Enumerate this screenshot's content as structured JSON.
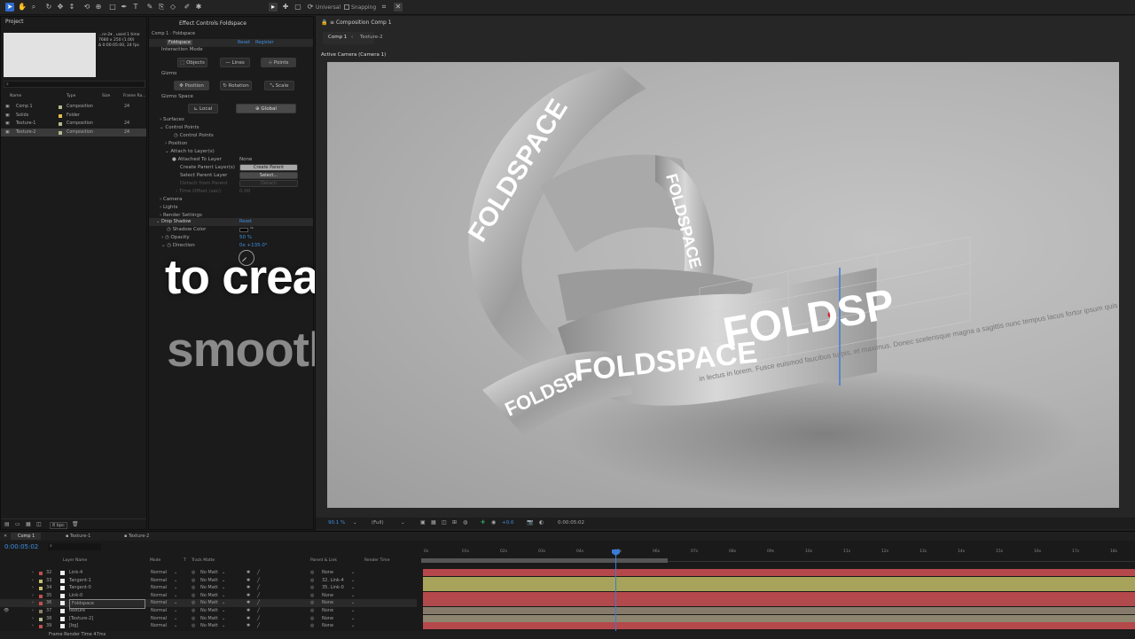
{
  "toolbar": {
    "universal_label": "Universal",
    "snapping_label": "Snapping"
  },
  "project": {
    "tab": "Project",
    "info_line1": "...re-2▾ , used 1 time",
    "info_line2": "7680 x 250 (1.00)",
    "info_line3": "Δ 0:00:05:00, 24 fps",
    "search_placeholder": "⌕",
    "col_name": "Name",
    "col_type": "Type",
    "col_size": "Size",
    "col_rate": "Frame Ra...",
    "items": [
      {
        "name": "Comp 1",
        "type": "Composition",
        "rate": "24",
        "color": "#b8b88f"
      },
      {
        "name": "Solids",
        "type": "Folder",
        "rate": "",
        "color": "#e0c04a"
      },
      {
        "name": "Texture-1",
        "type": "Composition",
        "rate": "24",
        "color": "#b8b88f"
      },
      {
        "name": "Texture-2",
        "type": "Composition",
        "rate": "24",
        "color": "#b8b88f"
      }
    ],
    "bpc": "8 bpc"
  },
  "effects": {
    "tab": "Effect Controls Foldspace",
    "breadcrumb": "Comp 1 · Foldspace",
    "effect_name": "Foldspace",
    "reset": "Reset",
    "register": "Register",
    "interaction_mode": "Interaction Mode",
    "objects": "Objects",
    "lines": "Lines",
    "points": "Points",
    "gizmo": "Gizmo",
    "position": "Position",
    "rotation": "Rotation",
    "scale": "Scale",
    "gizmo_space": "Gizmo Space",
    "local": "Local",
    "global": "Global",
    "surfaces": "Surfaces",
    "control_points": "Control Points",
    "control_points_sub": "Control Points",
    "position_sub": "Position",
    "attach_to_layers": "Attach to Layer(s)",
    "attached_to_layer": "Attached To Layer",
    "attached_value": "None",
    "create_parent_layers": "Create Parent Layer(s)",
    "create_parent_btn": "Create Parent",
    "select_parent_layer": "Select Parent Layer",
    "select_btn": "Select...",
    "detach_from_parent": "Detach from Parent",
    "detach_btn": "Detach",
    "time_offset": "Time Offset (sec)",
    "time_offset_val": "0.00",
    "camera": "Camera",
    "lights": "Lights",
    "render_settings": "Render Settings",
    "drop_shadow": "Drop Shadow",
    "drop_shadow_reset": "Reset",
    "shadow_color": "Shadow Color",
    "opacity": "Opacity",
    "opacity_val": "50 %",
    "direction": "Direction",
    "direction_val": "0x +135.0°"
  },
  "overlay": {
    "line1": "to create",
    "line2": "smooth"
  },
  "composition": {
    "tab": "Composition Comp 1",
    "sub_tab1": "Comp 1",
    "sub_tab2": "Texture-2",
    "camera_label": "Active Camera (Camera 1)",
    "zoom": "90.1 %",
    "resolution": "(Full)",
    "exposure": "+0.0",
    "timecode": "0:00:05:02"
  },
  "timeline": {
    "tabs": [
      "Comp 1",
      "Texture-1",
      "Texture-2"
    ],
    "timecode": "0:00:05:02",
    "frame_render": "Frame Render Time 47ms",
    "col_layer_name": "Layer Name",
    "col_mode": "Mode",
    "col_t": "T",
    "col_track_matte": "Track Matte",
    "col_parent": "Parent & Link",
    "col_render_time": "Render Time",
    "ruler": [
      "0s",
      "01s",
      "02s",
      "03s",
      "04s",
      "05s",
      "06s",
      "07s",
      "08s",
      "09s",
      "10s",
      "11s",
      "12s",
      "13s",
      "14s",
      "15s",
      "16s",
      "17s",
      "18s"
    ],
    "layers": [
      {
        "num": "32",
        "name": "Link-4",
        "mode": "Normal",
        "matte": "No Matt",
        "parent": "None",
        "color": "#c0504d",
        "track": "#b5484a"
      },
      {
        "num": "33",
        "name": "Tangent-1",
        "mode": "Normal",
        "matte": "No Matt",
        "parent": "32. Link-4",
        "color": "#c8c06a",
        "track": "#a7a35a"
      },
      {
        "num": "34",
        "name": "Tangent-0",
        "mode": "Normal",
        "matte": "No Matt",
        "parent": "35. Link-0",
        "color": "#c8c06a",
        "track": "#a7a35a"
      },
      {
        "num": "35",
        "name": "Link-0",
        "mode": "Normal",
        "matte": "No Matt",
        "parent": "None",
        "color": "#c0504d",
        "track": "#b5484a"
      },
      {
        "num": "36",
        "name": "Foldspace",
        "mode": "Normal",
        "matte": "No Matt",
        "parent": "None",
        "color": "#c0504d",
        "track": "#b04a4c"
      },
      {
        "num": "37",
        "name": "texture",
        "mode": "Normal",
        "matte": "No Matt",
        "parent": "None",
        "color": "#8d7f6a",
        "track": "#867b6a"
      },
      {
        "num": "38",
        "name": "[Texture-2]",
        "mode": "Normal",
        "matte": "No Matt",
        "parent": "None",
        "color": "#b8b88f",
        "track": "#8d8570"
      },
      {
        "num": "39",
        "name": "[bg]",
        "mode": "Normal",
        "matte": "No Matt",
        "parent": "None",
        "color": "#c0504d",
        "track": "#b5484a"
      }
    ]
  },
  "scene": {
    "band_text": "FOLDSPACE",
    "band_text_partial": "FOLDSP",
    "lorem": "in lectus in lorem. Fusce euismod faucibus turpis, et maximus. Donec scelerisque magna a sagittis nunc tempus lacus fortor ipsum quis risus."
  }
}
